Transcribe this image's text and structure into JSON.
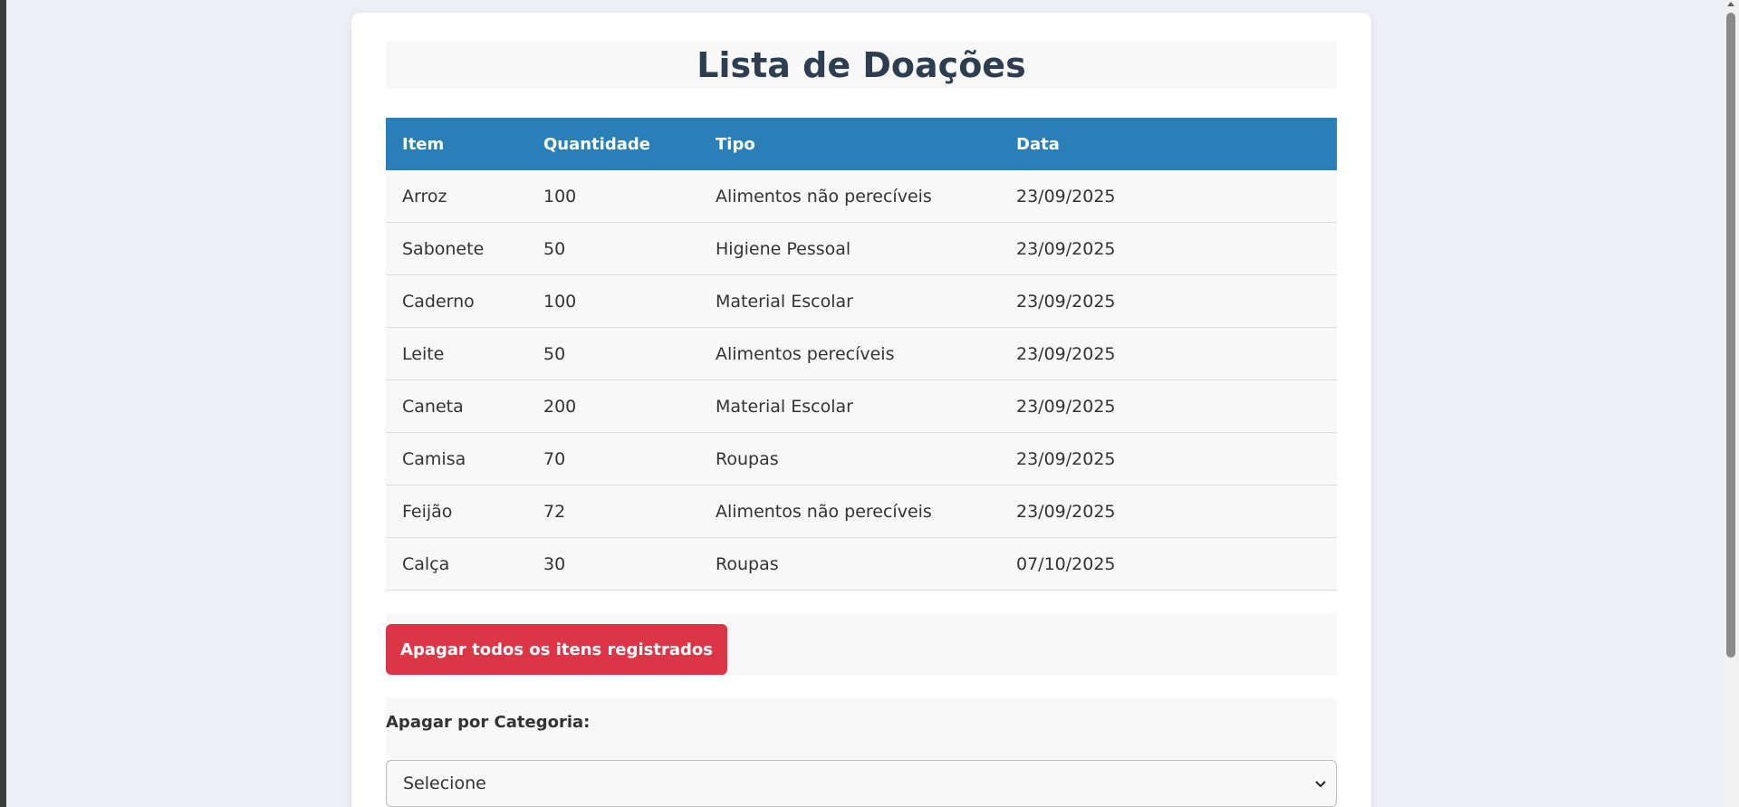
{
  "page": {
    "title": "Lista de Doações"
  },
  "table": {
    "headers": [
      "Item",
      "Quantidade",
      "Tipo",
      "Data"
    ],
    "rows": [
      [
        "Arroz",
        "100",
        "Alimentos não perecíveis",
        "23/09/2025"
      ],
      [
        "Sabonete",
        "50",
        "Higiene Pessoal",
        "23/09/2025"
      ],
      [
        "Caderno",
        "100",
        "Material Escolar",
        "23/09/2025"
      ],
      [
        "Leite",
        "50",
        "Alimentos perecíveis",
        "23/09/2025"
      ],
      [
        "Caneta",
        "200",
        "Material Escolar",
        "23/09/2025"
      ],
      [
        "Camisa",
        "70",
        "Roupas",
        "23/09/2025"
      ],
      [
        "Feijão",
        "72",
        "Alimentos não perecíveis",
        "23/09/2025"
      ],
      [
        "Calça",
        "30",
        "Roupas",
        "07/10/2025"
      ]
    ]
  },
  "actions": {
    "delete_all_label": "Apagar todos os itens registrados",
    "delete_by_category_label": "Apagar por Categoria:",
    "category_select_value": "Selecione"
  },
  "colors": {
    "header_blue": "#2980b9",
    "delete_red": "#dc3545",
    "title_dark": "#2c3e50",
    "page_bg": "#edf0f5"
  },
  "icons": {
    "select_chevron": "chevron-down-icon"
  }
}
